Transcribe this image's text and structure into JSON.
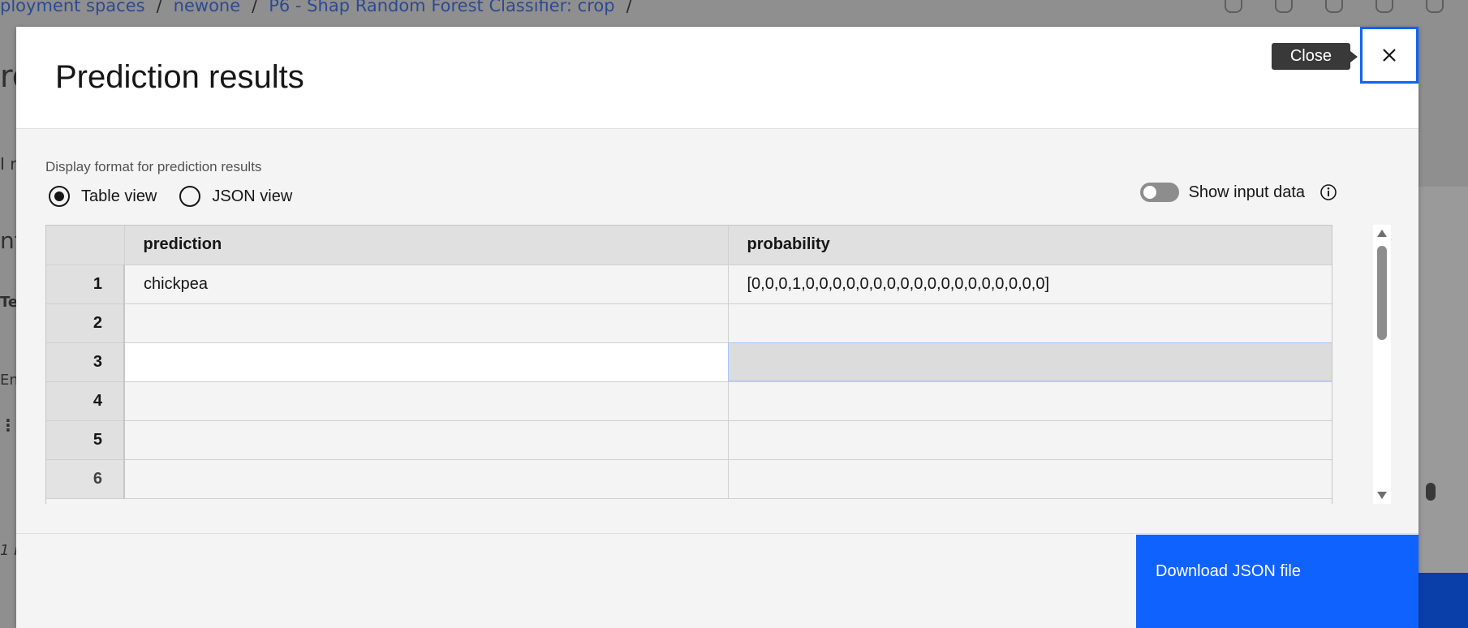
{
  "background": {
    "breadcrumb": [
      "ployment spaces",
      "newone",
      "P6 - Shap Random Forest Classifier: crop"
    ],
    "separator": "/",
    "left_fragments": {
      "f1": "ro",
      "f2": "I r",
      "f3": "nt",
      "f4": "Te",
      "f5": "En",
      "f6": "⋮",
      "f7": "1 r"
    }
  },
  "modal": {
    "title": "Prediction results",
    "close_tooltip": "Close",
    "format_label": "Display format for prediction results",
    "radio": {
      "table": "Table view",
      "json": "JSON view",
      "selected": "table"
    },
    "toggle": {
      "label": "Show input data",
      "on": false
    },
    "table": {
      "columns": [
        "prediction",
        "probability"
      ],
      "rows": [
        {
          "index": "1",
          "prediction": "chickpea",
          "probability": "[0,0,0,1,0,0,0,0,0,0,0,0,0,0,0,0,0,0,0,0,0,0]"
        },
        {
          "index": "2",
          "prediction": "",
          "probability": ""
        },
        {
          "index": "3",
          "prediction": "",
          "probability": ""
        },
        {
          "index": "4",
          "prediction": "",
          "probability": ""
        },
        {
          "index": "5",
          "prediction": "",
          "probability": ""
        },
        {
          "index": "6",
          "prediction": "",
          "probability": ""
        }
      ]
    },
    "download_label": "Download JSON file"
  },
  "colors": {
    "primary": "#0f62fe",
    "tooltip_bg": "#393939",
    "header_cell": "#e0e0e0"
  }
}
